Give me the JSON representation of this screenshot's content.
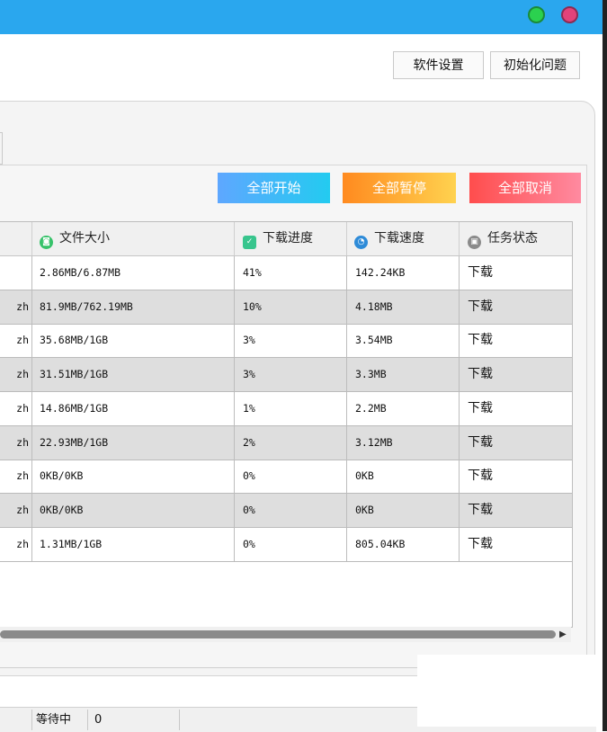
{
  "toolbar": {
    "settings_label": "软件设置",
    "init_label": "初始化问题"
  },
  "actions": {
    "start_all": "全部开始",
    "pause_all": "全部暂停",
    "cancel_all": "全部取消"
  },
  "table": {
    "columns": [
      "文件大小",
      "下载进度",
      "下载速度",
      "任务状态"
    ],
    "rows": [
      {
        "name": "",
        "size": "2.86MB/6.87MB",
        "progress": "41%",
        "speed": "142.24KB",
        "status": "下载"
      },
      {
        "name": "zh",
        "size": "81.9MB/762.19MB",
        "progress": "10%",
        "speed": "4.18MB",
        "status": "下载"
      },
      {
        "name": "zh",
        "size": "35.68MB/1GB",
        "progress": "3%",
        "speed": "3.54MB",
        "status": "下载"
      },
      {
        "name": "zh",
        "size": "31.51MB/1GB",
        "progress": "3%",
        "speed": "3.3MB",
        "status": "下载"
      },
      {
        "name": "zh",
        "size": "14.86MB/1GB",
        "progress": "1%",
        "speed": "2.2MB",
        "status": "下载"
      },
      {
        "name": "zh",
        "size": "22.93MB/1GB",
        "progress": "2%",
        "speed": "3.12MB",
        "status": "下载"
      },
      {
        "name": "zh",
        "size": "0KB/0KB",
        "progress": "0%",
        "speed": "0KB",
        "status": "下载"
      },
      {
        "name": "zh",
        "size": "0KB/0KB",
        "progress": "0%",
        "speed": "0KB",
        "status": "下载"
      },
      {
        "name": "zh",
        "size": "1.31MB/1GB",
        "progress": "0%",
        "speed": "805.04KB",
        "status": "下载"
      }
    ]
  },
  "statusbar": {
    "waiting_label": "等待中",
    "waiting_count": "0"
  },
  "icons": {
    "size_col": "disk-icon",
    "progress_col": "check-icon",
    "speed_col": "speed-icon",
    "status_col": "lock-icon",
    "titlebar": [
      "maximize-circle-icon",
      "close-circle-icon"
    ]
  },
  "colors": {
    "titlebar": "#2aa7ee",
    "start_btn": "#4fb0fb",
    "pause_btn": "#ffa936",
    "cancel_btn": "#ff6d79",
    "alt_row": "#dedede",
    "circle_green": "#2bd14f",
    "circle_pink": "#e2437a"
  }
}
